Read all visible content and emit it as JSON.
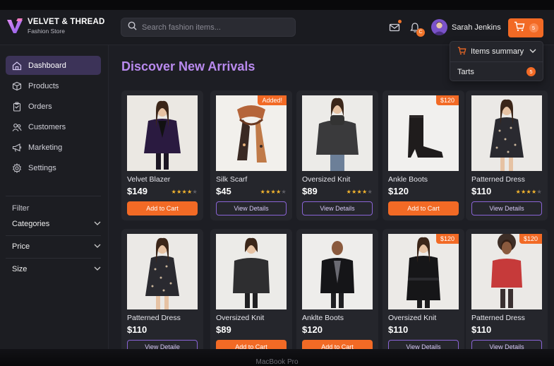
{
  "brand": {
    "name": "VELVET & THREAD",
    "tagline": "Fashion Store",
    "logo_color": "#c06cf0"
  },
  "header": {
    "search_placeholder": "Search fashion items...",
    "notification_count": "C",
    "user_name": "Sarah Jenkins",
    "cart_count": "5"
  },
  "cart_dropdown": {
    "title": "Items summary",
    "item_label": "Tarts",
    "item_count": "5"
  },
  "sidebar": {
    "items": [
      {
        "label": "Dashboard",
        "icon": "home-icon",
        "active": true
      },
      {
        "label": "Products",
        "icon": "box-icon",
        "active": false
      },
      {
        "label": "Orders",
        "icon": "clipboard-icon",
        "active": false
      },
      {
        "label": "Customers",
        "icon": "users-icon",
        "active": false
      },
      {
        "label": "Marketing",
        "icon": "megaphone-icon",
        "active": false
      },
      {
        "label": "Settings",
        "icon": "gear-icon",
        "active": false
      }
    ],
    "filter_title": "Filter",
    "filters": [
      {
        "label": "Categories"
      },
      {
        "label": "Price"
      },
      {
        "label": "Size"
      }
    ]
  },
  "main": {
    "title": "Discover New Arrivals"
  },
  "products": [
    {
      "name": "Velvet Blazer",
      "price": "$149",
      "rating": 4,
      "badge": "",
      "button": "Add to Cart",
      "button_type": "cart",
      "kind": "blazer-woman"
    },
    {
      "name": "Silk Scarf",
      "price": "$45",
      "rating": 4,
      "badge": "Added!",
      "button": "View Details",
      "button_type": "details",
      "kind": "scarf"
    },
    {
      "name": "Oversized Knit",
      "price": "$89",
      "rating": 4,
      "badge": "",
      "button": "View Details",
      "button_type": "details",
      "kind": "knit-woman"
    },
    {
      "name": "Ankle Boots",
      "price": "$120",
      "rating": 0,
      "badge": "$120",
      "button": "Add to Cart",
      "button_type": "cart",
      "kind": "boots"
    },
    {
      "name": "Patterned Dress",
      "price": "$110",
      "rating": 4,
      "badge": "",
      "button": "View Details",
      "button_type": "details",
      "kind": "dress"
    },
    {
      "name": "Patterned Dress",
      "price": "$110",
      "rating": 0,
      "badge": "",
      "button": "View Detaile",
      "button_type": "details",
      "kind": "dress"
    },
    {
      "name": "Oversized Knit",
      "price": "$89",
      "rating": 0,
      "badge": "",
      "button": "Add to Cart",
      "button_type": "cart",
      "kind": "knit-man"
    },
    {
      "name": "Anklte Boots",
      "price": "$120",
      "rating": 0,
      "badge": "",
      "button": "Add to Cart",
      "button_type": "cart",
      "kind": "jacket-man"
    },
    {
      "name": "Oversized Knit",
      "price": "$110",
      "rating": 0,
      "badge": "$120",
      "button": "View Details",
      "button_type": "details",
      "kind": "coat"
    },
    {
      "name": "Patterned Dress",
      "price": "$110",
      "rating": 0,
      "badge": "$120",
      "button": "View Details",
      "button_type": "details",
      "kind": "red-top"
    }
  ],
  "footer": {
    "device_label": "MacBook Pro"
  },
  "colors": {
    "accent": "#f26a25",
    "purple": "#b98aee",
    "active_nav": "#3c3358"
  }
}
